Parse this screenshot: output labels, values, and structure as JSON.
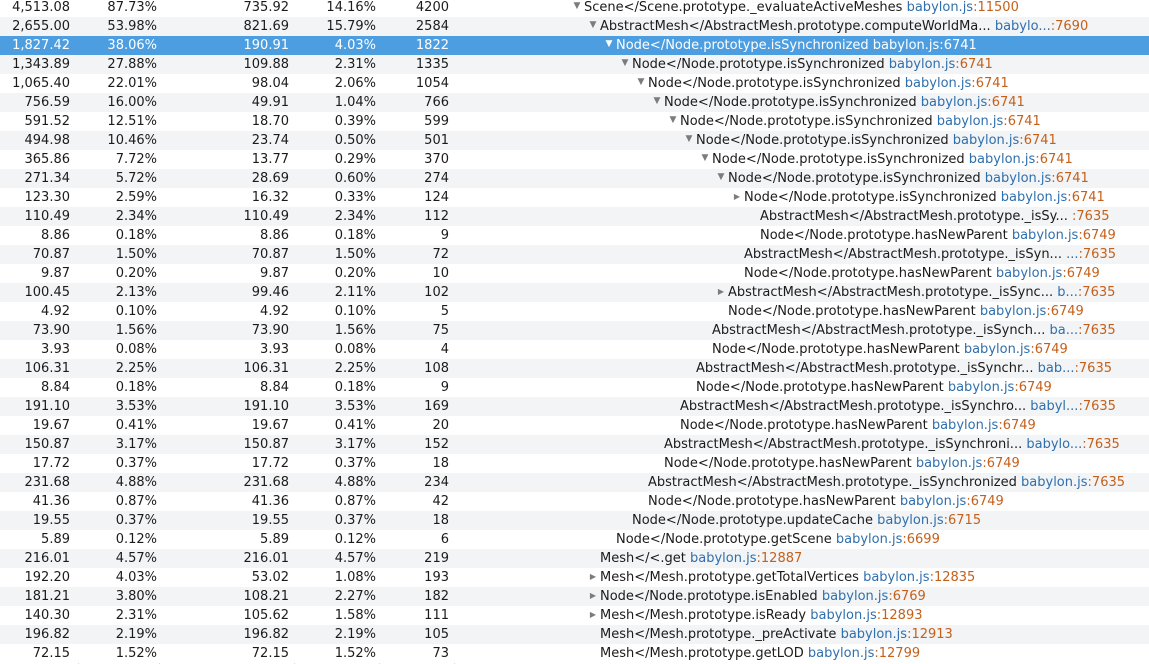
{
  "colors": {
    "selected_row": "#4d9ee0",
    "alt_row": "#f2f4f6",
    "file_link": "#2f6fad",
    "line_number": "#c5601a"
  },
  "rows": [
    {
      "total_time": "4,513.08",
      "total_pct": "87.73%",
      "self_time": "735.92",
      "self_pct": "14.16%",
      "samples": "4200",
      "func": "Scene</Scene.prototype._evaluateActiveMeshes",
      "file": "babylon.js",
      "line": "11500",
      "twisty": "expanded"
    },
    {
      "total_time": "2,655.00",
      "total_pct": "53.98%",
      "self_time": "821.69",
      "self_pct": "15.79%",
      "samples": "2584",
      "func": "AbstractMesh</AbstractMesh.prototype.computeWorldMa...",
      "file": "babylo...",
      "line": "7690",
      "twisty": "expanded"
    },
    {
      "total_time": "1,827.42",
      "total_pct": "38.06%",
      "self_time": "190.91",
      "self_pct": "4.03%",
      "samples": "1822",
      "func": "Node</Node.prototype.isSynchronized",
      "file": "babylon.js",
      "line": "6741",
      "twisty": "expanded",
      "selected": true
    },
    {
      "total_time": "1,343.89",
      "total_pct": "27.88%",
      "self_time": "109.88",
      "self_pct": "2.31%",
      "samples": "1335",
      "func": "Node</Node.prototype.isSynchronized",
      "file": "babylon.js",
      "line": "6741",
      "twisty": "expanded"
    },
    {
      "total_time": "1,065.40",
      "total_pct": "22.01%",
      "self_time": "98.04",
      "self_pct": "2.06%",
      "samples": "1054",
      "func": "Node</Node.prototype.isSynchronized",
      "file": "babylon.js",
      "line": "6741",
      "twisty": "expanded"
    },
    {
      "total_time": "756.59",
      "total_pct": "16.00%",
      "self_time": "49.91",
      "self_pct": "1.04%",
      "samples": "766",
      "func": "Node</Node.prototype.isSynchronized",
      "file": "babylon.js",
      "line": "6741",
      "twisty": "expanded"
    },
    {
      "total_time": "591.52",
      "total_pct": "12.51%",
      "self_time": "18.70",
      "self_pct": "0.39%",
      "samples": "599",
      "func": "Node</Node.prototype.isSynchronized",
      "file": "babylon.js",
      "line": "6741",
      "twisty": "expanded"
    },
    {
      "total_time": "494.98",
      "total_pct": "10.46%",
      "self_time": "23.74",
      "self_pct": "0.50%",
      "samples": "501",
      "func": "Node</Node.prototype.isSynchronized",
      "file": "babylon.js",
      "line": "6741",
      "twisty": "expanded"
    },
    {
      "total_time": "365.86",
      "total_pct": "7.72%",
      "self_time": "13.77",
      "self_pct": "0.29%",
      "samples": "370",
      "func": "Node</Node.prototype.isSynchronized",
      "file": "babylon.js",
      "line": "6741",
      "twisty": "expanded"
    },
    {
      "total_time": "271.34",
      "total_pct": "5.72%",
      "self_time": "28.69",
      "self_pct": "0.60%",
      "samples": "274",
      "func": "Node</Node.prototype.isSynchronized",
      "file": "babylon.js",
      "line": "6741",
      "twisty": "expanded"
    },
    {
      "total_time": "123.30",
      "total_pct": "2.59%",
      "self_time": "16.32",
      "self_pct": "0.33%",
      "samples": "124",
      "func": "Node</Node.prototype.isSynchronized",
      "file": "babylon.js",
      "line": "6741",
      "twisty": "collapsed"
    },
    {
      "total_time": "110.49",
      "total_pct": "2.34%",
      "self_time": "110.49",
      "self_pct": "2.34%",
      "samples": "112",
      "func": "AbstractMesh</AbstractMesh.prototype._isSy...",
      "file": "",
      "line": "7635",
      "twisty": "none"
    },
    {
      "total_time": "8.86",
      "total_pct": "0.18%",
      "self_time": "8.86",
      "self_pct": "0.18%",
      "samples": "9",
      "func": "Node</Node.prototype.hasNewParent",
      "file": "babylon.js",
      "line": "6749",
      "twisty": "none"
    },
    {
      "total_time": "70.87",
      "total_pct": "1.50%",
      "self_time": "70.87",
      "self_pct": "1.50%",
      "samples": "72",
      "func": "AbstractMesh</AbstractMesh.prototype._isSyn...",
      "file": "...",
      "line": "7635",
      "twisty": "none"
    },
    {
      "total_time": "9.87",
      "total_pct": "0.20%",
      "self_time": "9.87",
      "self_pct": "0.20%",
      "samples": "10",
      "func": "Node</Node.prototype.hasNewParent",
      "file": "babylon.js",
      "line": "6749",
      "twisty": "none"
    },
    {
      "total_time": "100.45",
      "total_pct": "2.13%",
      "self_time": "99.46",
      "self_pct": "2.11%",
      "samples": "102",
      "func": "AbstractMesh</AbstractMesh.prototype._isSync...",
      "file": "b...",
      "line": "7635",
      "twisty": "collapsed"
    },
    {
      "total_time": "4.92",
      "total_pct": "0.10%",
      "self_time": "4.92",
      "self_pct": "0.10%",
      "samples": "5",
      "func": "Node</Node.prototype.hasNewParent",
      "file": "babylon.js",
      "line": "6749",
      "twisty": "none"
    },
    {
      "total_time": "73.90",
      "total_pct": "1.56%",
      "self_time": "73.90",
      "self_pct": "1.56%",
      "samples": "75",
      "func": "AbstractMesh</AbstractMesh.prototype._isSynch...",
      "file": "ba...",
      "line": "7635",
      "twisty": "none"
    },
    {
      "total_time": "3.93",
      "total_pct": "0.08%",
      "self_time": "3.93",
      "self_pct": "0.08%",
      "samples": "4",
      "func": "Node</Node.prototype.hasNewParent",
      "file": "babylon.js",
      "line": "6749",
      "twisty": "none"
    },
    {
      "total_time": "106.31",
      "total_pct": "2.25%",
      "self_time": "106.31",
      "self_pct": "2.25%",
      "samples": "108",
      "func": "AbstractMesh</AbstractMesh.prototype._isSynchr...",
      "file": "bab...",
      "line": "7635",
      "twisty": "none"
    },
    {
      "total_time": "8.84",
      "total_pct": "0.18%",
      "self_time": "8.84",
      "self_pct": "0.18%",
      "samples": "9",
      "func": "Node</Node.prototype.hasNewParent",
      "file": "babylon.js",
      "line": "6749",
      "twisty": "none"
    },
    {
      "total_time": "191.10",
      "total_pct": "3.53%",
      "self_time": "191.10",
      "self_pct": "3.53%",
      "samples": "169",
      "func": "AbstractMesh</AbstractMesh.prototype._isSynchro...",
      "file": "babyl...",
      "line": "7635",
      "twisty": "none"
    },
    {
      "total_time": "19.67",
      "total_pct": "0.41%",
      "self_time": "19.67",
      "self_pct": "0.41%",
      "samples": "20",
      "func": "Node</Node.prototype.hasNewParent",
      "file": "babylon.js",
      "line": "6749",
      "twisty": "none"
    },
    {
      "total_time": "150.87",
      "total_pct": "3.17%",
      "self_time": "150.87",
      "self_pct": "3.17%",
      "samples": "152",
      "func": "AbstractMesh</AbstractMesh.prototype._isSynchroni...",
      "file": "babylo...",
      "line": "7635",
      "twisty": "none"
    },
    {
      "total_time": "17.72",
      "total_pct": "0.37%",
      "self_time": "17.72",
      "self_pct": "0.37%",
      "samples": "18",
      "func": "Node</Node.prototype.hasNewParent",
      "file": "babylon.js",
      "line": "6749",
      "twisty": "none"
    },
    {
      "total_time": "231.68",
      "total_pct": "4.88%",
      "self_time": "231.68",
      "self_pct": "4.88%",
      "samples": "234",
      "func": "AbstractMesh</AbstractMesh.prototype._isSynchronized",
      "file": "babylon.js",
      "line": "7635",
      "twisty": "none"
    },
    {
      "total_time": "41.36",
      "total_pct": "0.87%",
      "self_time": "41.36",
      "self_pct": "0.87%",
      "samples": "42",
      "func": "Node</Node.prototype.hasNewParent",
      "file": "babylon.js",
      "line": "6749",
      "twisty": "none"
    },
    {
      "total_time": "19.55",
      "total_pct": "0.37%",
      "self_time": "19.55",
      "self_pct": "0.37%",
      "samples": "18",
      "func": "Node</Node.prototype.updateCache",
      "file": "babylon.js",
      "line": "6715",
      "twisty": "none"
    },
    {
      "total_time": "5.89",
      "total_pct": "0.12%",
      "self_time": "5.89",
      "self_pct": "0.12%",
      "samples": "6",
      "func": "Node</Node.prototype.getScene",
      "file": "babylon.js",
      "line": "6699",
      "twisty": "none"
    },
    {
      "total_time": "216.01",
      "total_pct": "4.57%",
      "self_time": "216.01",
      "self_pct": "4.57%",
      "samples": "219",
      "func": "Mesh</<.get",
      "file": "babylon.js",
      "line": "12887",
      "twisty": "none"
    },
    {
      "total_time": "192.20",
      "total_pct": "4.03%",
      "self_time": "53.02",
      "self_pct": "1.08%",
      "samples": "193",
      "func": "Mesh</Mesh.prototype.getTotalVertices",
      "file": "babylon.js",
      "line": "12835",
      "twisty": "collapsed"
    },
    {
      "total_time": "181.21",
      "total_pct": "3.80%",
      "self_time": "108.21",
      "self_pct": "2.27%",
      "samples": "182",
      "func": "Node</Node.prototype.isEnabled",
      "file": "babylon.js",
      "line": "6769",
      "twisty": "collapsed"
    },
    {
      "total_time": "140.30",
      "total_pct": "2.31%",
      "self_time": "105.62",
      "self_pct": "1.58%",
      "samples": "111",
      "func": "Mesh</Mesh.prototype.isReady",
      "file": "babylon.js",
      "line": "12893",
      "twisty": "collapsed"
    },
    {
      "total_time": "196.82",
      "total_pct": "2.19%",
      "self_time": "196.82",
      "self_pct": "2.19%",
      "samples": "105",
      "func": "Mesh</Mesh.prototype._preActivate",
      "file": "babylon.js",
      "line": "12913",
      "twisty": "none"
    },
    {
      "total_time": "72.15",
      "total_pct": "1.52%",
      "self_time": "72.15",
      "self_pct": "1.52%",
      "samples": "73",
      "func": "Mesh</Mesh.prototype.getLOD",
      "file": "babylon.js",
      "line": "12799",
      "twisty": "none"
    }
  ]
}
